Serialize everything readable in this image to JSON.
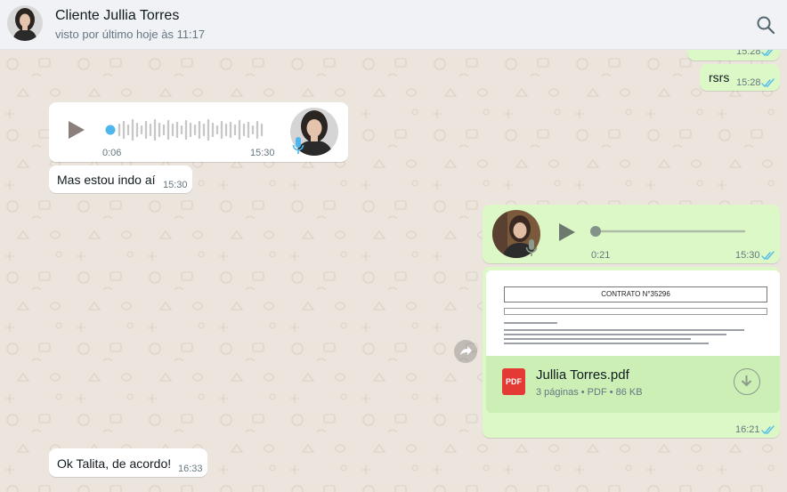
{
  "header": {
    "title": "Cliente Jullia Torres",
    "status": "visto por último hoje às 11:17"
  },
  "messages": {
    "m1": {
      "time": "15:28"
    },
    "m2": {
      "text": "rsrs",
      "time": "15:28"
    },
    "m3": {
      "duration": "0:06",
      "time": "15:30"
    },
    "m4": {
      "text": "Mas estou indo aí",
      "time": "15:30"
    },
    "m5": {
      "duration": "0:21",
      "time": "15:30"
    },
    "m6": {
      "preview_title": "CONTRATO N°35296",
      "file_name": "Jullia Torres.pdf",
      "file_meta": "3 páginas • PDF • 86 KB",
      "file_type": "PDF",
      "time": "16:21"
    },
    "m7": {
      "text": "Ok Talita, de acordo!",
      "time": "16:33"
    }
  },
  "colors": {
    "background": "#ece5dd",
    "incoming": "#ffffff",
    "outgoing": "#dcf8c6",
    "read_ticks": "#53bdeb",
    "pdf": "#e53935"
  }
}
